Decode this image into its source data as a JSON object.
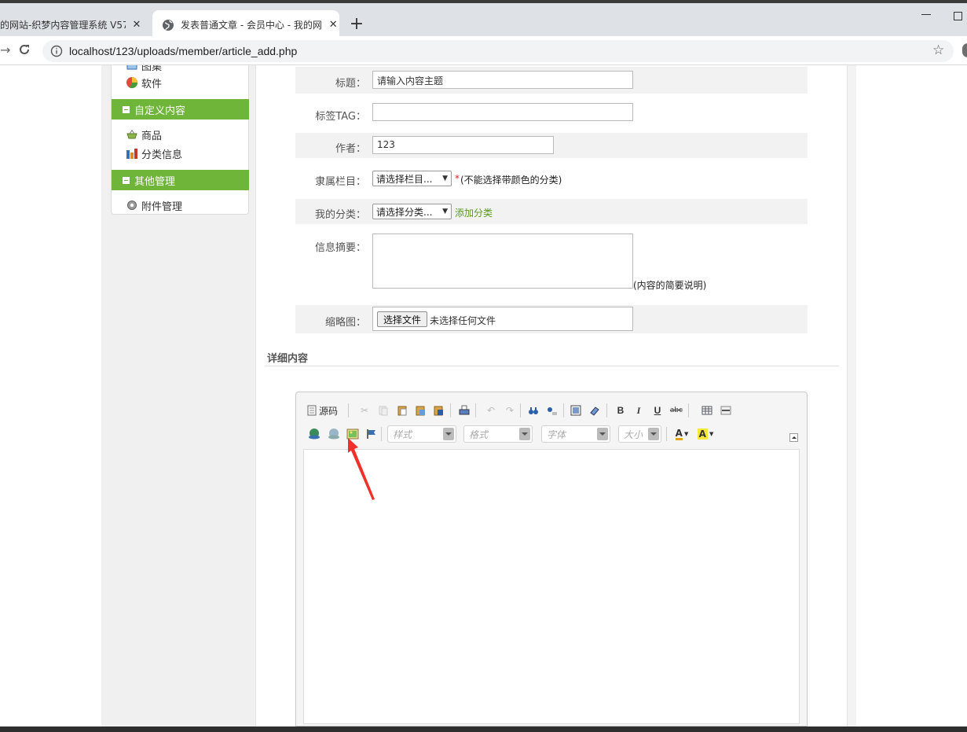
{
  "browser": {
    "tabs": [
      {
        "title": "的网站-织梦内容管理系统 V57",
        "close": "✕"
      },
      {
        "title": "发表普通文章 - 会员中心 - 我的网",
        "close": "✕"
      }
    ],
    "new_tab": "+",
    "url": "localhost/123/uploads/member/article_add.php"
  },
  "sidebar": {
    "partial_item": "图集",
    "software": "软件",
    "custom_header": "自定义内容",
    "goods": "商品",
    "classified": "分类信息",
    "other_header": "其他管理",
    "attachments": "附件管理"
  },
  "form": {
    "title_label": "标题：",
    "title_value": "请输入内容主题",
    "tag_label": "标签TAG：",
    "tag_value": "",
    "author_label": "作者：",
    "author_value": "123",
    "column_label": "隶属栏目：",
    "column_select": "请选择栏目...",
    "column_required": "*",
    "column_note": "(不能选择带颜色的分类)",
    "mycat_label": "我的分类：",
    "mycat_select": "请选择分类...",
    "mycat_add": "添加分类",
    "summary_label": "信息摘要：",
    "summary_note": "(内容的简要说明)",
    "thumb_label": "缩略图：",
    "file_button": "选择文件",
    "file_status": "未选择任何文件"
  },
  "detail": {
    "section_title": "详细内容",
    "source_button": "源码",
    "combo_style": "样式",
    "combo_format": "格式",
    "combo_font": "字体",
    "combo_size": "大小",
    "bold": "B",
    "italic": "I",
    "underline": "U",
    "strike": "abc",
    "font_color": "A",
    "bg_color": "A"
  }
}
